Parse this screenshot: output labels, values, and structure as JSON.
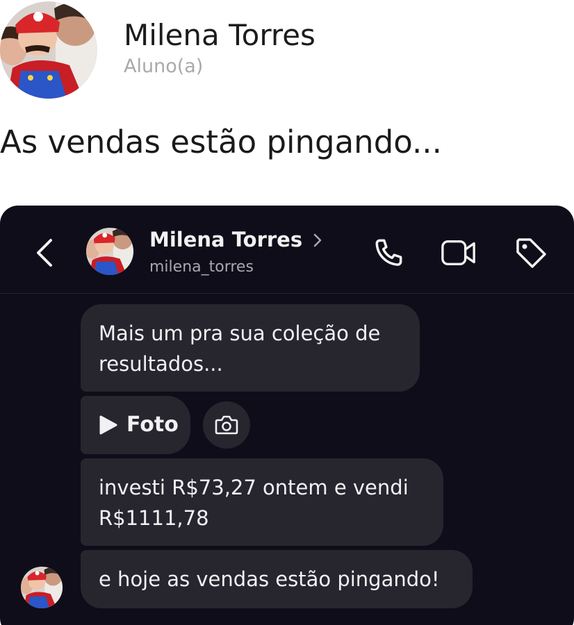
{
  "profile": {
    "name": "Milena Torres",
    "role": "Aluno(a)"
  },
  "post": {
    "text": "As vendas estão pingando..."
  },
  "chat": {
    "header": {
      "name": "Milena Torres",
      "handle": "milena_torres",
      "icons": [
        "back-chevron-icon",
        "phone-icon",
        "video-camera-icon",
        "tag-icon"
      ]
    },
    "messages": [
      {
        "text": "Mais um pra sua coleção de resultados..."
      },
      {
        "media_label": "Foto",
        "media_icon": "play-icon",
        "action_icon": "camera-icon"
      },
      {
        "text": "investi R$73,27 ontem e vendi R$1111,78"
      },
      {
        "text": "e hoje as vendas estão pingando!"
      }
    ]
  },
  "colors": {
    "chat_background": "#0e0d19",
    "bubble": "#27262f",
    "name_text": "#1c1c1c",
    "role_text": "#a9a9a9"
  }
}
